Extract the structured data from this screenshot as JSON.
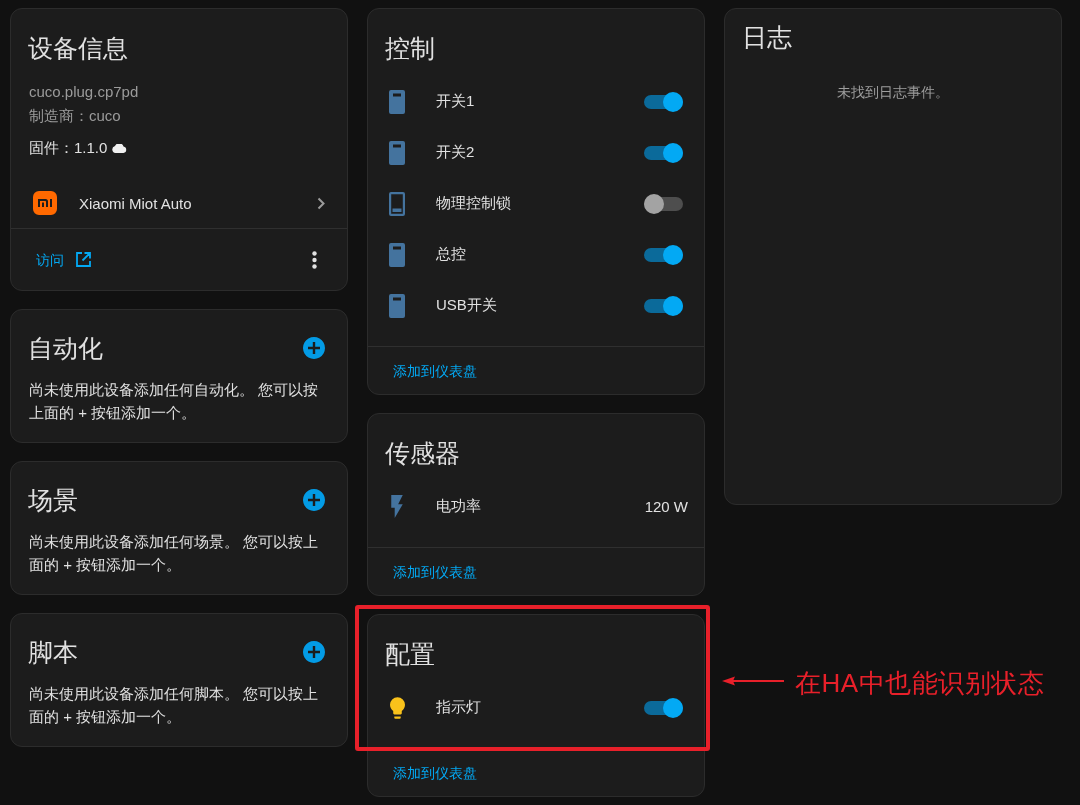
{
  "device_info": {
    "title": "设备信息",
    "model": "cuco.plug.cp7pd",
    "manufacturer": "制造商：cuco",
    "firmware": "固件：1.1.0",
    "integration": "Xiaomi Miot Auto",
    "visit_link": "访问"
  },
  "related_cards": [
    {
      "title": "自动化",
      "message": "尚未使用此设备添加任何自动化。 您可以按上面的 + 按钮添加一个。"
    },
    {
      "title": "场景",
      "message": "尚未使用此设备添加任何场景。 您可以按上面的 + 按钮添加一个。"
    },
    {
      "title": "脚本",
      "message": "尚未使用此设备添加任何脚本。 您可以按上面的 + 按钮添加一个。"
    }
  ],
  "entity_cards": [
    {
      "title": "控制",
      "rows": [
        {
          "kind": "switch",
          "label": "开关1",
          "on": true
        },
        {
          "kind": "switch",
          "label": "开关2",
          "on": true
        },
        {
          "kind": "switch",
          "label": "物理控制锁",
          "on": false
        },
        {
          "kind": "switch",
          "label": "总控",
          "on": true
        },
        {
          "kind": "switch",
          "label": "USB开关",
          "on": true
        }
      ],
      "footer_link": "添加到仪表盘"
    },
    {
      "title": "传感器",
      "rows": [
        {
          "kind": "sensor",
          "label": "电功率",
          "value": "120 W"
        }
      ],
      "footer_link": "添加到仪表盘"
    },
    {
      "title": "配置",
      "rows": [
        {
          "kind": "light",
          "label": "指示灯",
          "on": true
        }
      ],
      "footer_link": "添加到仪表盘"
    }
  ],
  "logbook": {
    "title": "日志",
    "empty_message": "未找到日志事件。"
  },
  "annotation": {
    "text": "在HA中也能识别状态"
  }
}
